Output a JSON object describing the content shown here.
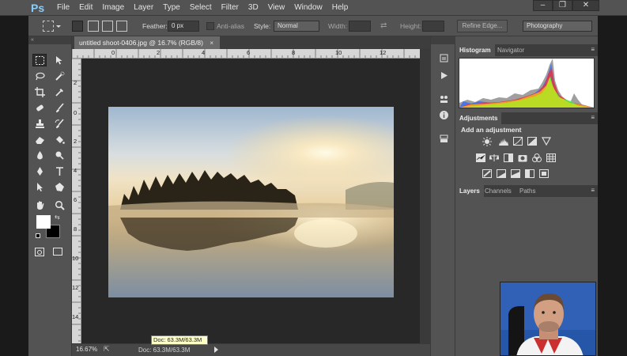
{
  "app": {
    "logo": "Ps"
  },
  "menu": [
    "File",
    "Edit",
    "Image",
    "Layer",
    "Type",
    "Select",
    "Filter",
    "3D",
    "View",
    "Window",
    "Help"
  ],
  "window_buttons": {
    "minimize": "–",
    "restore": "❐",
    "close": "✕"
  },
  "options_bar": {
    "feather_label": "Feather:",
    "feather_value": "0 px",
    "anti_alias_label": "Anti-alias",
    "style_label": "Style:",
    "style_value": "Normal",
    "width_label": "Width:",
    "height_label": "Height:",
    "refine_edge": "Refine Edge...",
    "workspace": "Photography"
  },
  "document": {
    "tab_title": "untitled shoot-0406.jpg @ 16.7% (RGB/8)",
    "tab_close": "×",
    "ruler_top": [
      "0",
      "2",
      "4",
      "6",
      "8",
      "10",
      "12",
      "14",
      "16",
      "18",
      "20"
    ],
    "ruler_left": [
      "2",
      "0",
      "2",
      "4",
      "6",
      "8",
      "10",
      "12",
      "14"
    ]
  },
  "status": {
    "zoom": "16.67%",
    "doc_size": "Doc: 63.3M/63.3M",
    "tooltip": "Doc: 63.3M/63.3M"
  },
  "panels": {
    "top_tabs": [
      "Histogram",
      "Navigator"
    ],
    "adjust_tab": "Adjustments",
    "adjust_title": "Add an adjustment",
    "layer_tabs": [
      "Layers",
      "Channels",
      "Paths"
    ]
  },
  "tools_header": "« ",
  "icons": [
    "marquee-icon",
    "move-icon",
    "lasso-icon",
    "quick-select-icon",
    "crop-icon",
    "eyedropper-icon",
    "healing-icon",
    "brush-icon",
    "stamp-icon",
    "history-brush-icon",
    "eraser-icon",
    "paint-bucket-icon",
    "blur-icon",
    "dodge-icon",
    "pen-icon",
    "type-icon",
    "path-select-icon",
    "shape-icon",
    "hand-icon",
    "zoom-icon"
  ],
  "colors": {
    "foreground": "#ffffff",
    "background": "#000000"
  }
}
